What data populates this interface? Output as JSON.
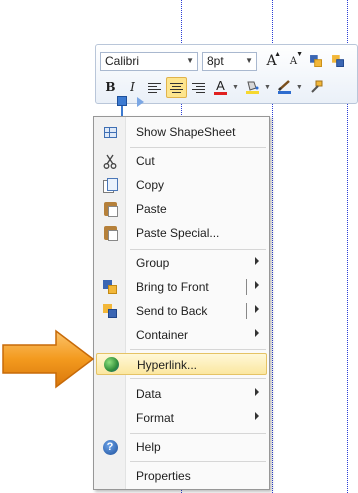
{
  "toolbar": {
    "font": "Calibri",
    "size": "8pt",
    "grow_font": "A",
    "shrink_font": "A",
    "bold": "B",
    "italic": "I",
    "font_color_letter": "A"
  },
  "menu": {
    "items": [
      {
        "label": "Show ShapeSheet",
        "icon": "shapesheet-icon"
      },
      {
        "label": "Cut",
        "icon": "scissors-icon"
      },
      {
        "label": "Copy",
        "icon": "copy-icon"
      },
      {
        "label": "Paste",
        "icon": "paste-icon"
      },
      {
        "label": "Paste Special...",
        "icon": "paste-special-icon"
      },
      {
        "label": "Group",
        "icon": ""
      },
      {
        "label": "Bring to Front",
        "icon": "bring-to-front-icon"
      },
      {
        "label": "Send to Back",
        "icon": "send-to-back-icon"
      },
      {
        "label": "Container",
        "icon": ""
      },
      {
        "label": "Hyperlink...",
        "icon": "hyperlink-globe-icon"
      },
      {
        "label": "Data",
        "icon": ""
      },
      {
        "label": "Format",
        "icon": ""
      },
      {
        "label": "Help",
        "icon": "help-icon"
      },
      {
        "label": "Properties",
        "icon": ""
      }
    ]
  },
  "help_glyph": "?",
  "colors": {
    "highlight": "#fbe7a0",
    "arrow": "#f39a1e",
    "guide": "#2b3fd6"
  }
}
